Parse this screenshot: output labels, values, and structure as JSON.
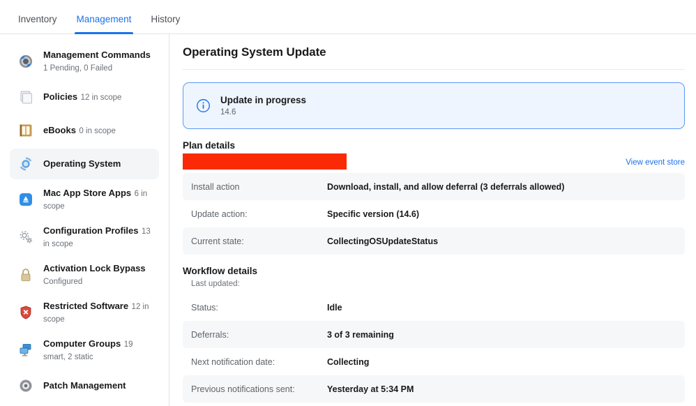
{
  "tabs": [
    {
      "label": "Inventory",
      "active": false
    },
    {
      "label": "Management",
      "active": true
    },
    {
      "label": "History",
      "active": false
    }
  ],
  "sidebar": {
    "items": [
      {
        "label": "Management Commands",
        "sub": "1 Pending, 0 Failed",
        "icon": "management-commands-icon",
        "active": false
      },
      {
        "label": "Policies",
        "sub": "12 in scope",
        "icon": "policies-icon",
        "active": false
      },
      {
        "label": "eBooks",
        "sub": "0 in scope",
        "icon": "ebooks-icon",
        "active": false
      },
      {
        "label": "Operating System",
        "sub": "",
        "icon": "operating-system-icon",
        "active": true
      },
      {
        "label": "Mac App Store Apps",
        "sub": "6 in scope",
        "icon": "mac-app-store-icon",
        "active": false
      },
      {
        "label": "Configuration Profiles",
        "sub": "13 in scope",
        "icon": "configuration-profiles-icon",
        "active": false
      },
      {
        "label": "Activation Lock Bypass",
        "sub": "Configured",
        "icon": "lock-icon",
        "active": false
      },
      {
        "label": "Restricted Software",
        "sub": "12 in scope",
        "icon": "restricted-software-icon",
        "active": false
      },
      {
        "label": "Computer Groups",
        "sub": "19 smart, 2 static",
        "icon": "computer-groups-icon",
        "active": false
      },
      {
        "label": "Patch Management",
        "sub": "",
        "icon": "patch-management-icon",
        "active": false
      }
    ]
  },
  "main": {
    "page_title": "Operating System Update",
    "banner": {
      "icon": "info-circle-icon",
      "title": "Update in progress",
      "subtitle": "14.6",
      "border_color": "#5b9bf5",
      "bg_color": "#eff5fe"
    },
    "plan_details": {
      "heading": "Plan details",
      "redaction_color": "#fa2a07",
      "event_store_link": "View event store",
      "rows": [
        {
          "label": "Install action",
          "value": "Download, install, and allow deferral (3 deferrals allowed)",
          "shaded": true
        },
        {
          "label": "Update action:",
          "value": "Specific version (14.6)",
          "shaded": false
        },
        {
          "label": "Current state:",
          "value": "CollectingOSUpdateStatus",
          "shaded": true
        }
      ]
    },
    "workflow_details": {
      "heading": "Workflow details",
      "last_updated_label": "Last updated:",
      "rows": [
        {
          "label": "Status:",
          "value": "Idle",
          "shaded": false
        },
        {
          "label": "Deferrals:",
          "value": "3 of 3 remaining",
          "shaded": true
        },
        {
          "label": "Next notification date:",
          "value": "Collecting",
          "shaded": false
        },
        {
          "label": "Previous notifications sent:",
          "value": "Yesterday at 5:34 PM",
          "shaded": true
        }
      ]
    }
  }
}
